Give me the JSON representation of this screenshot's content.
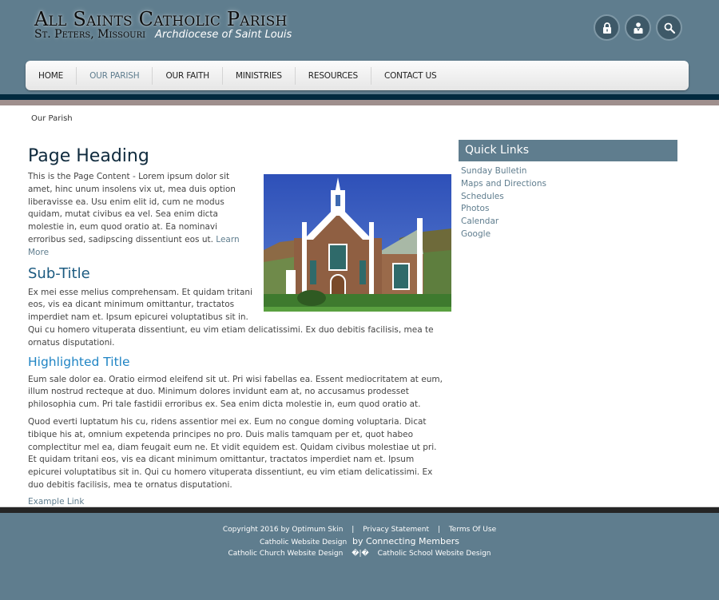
{
  "header": {
    "title": "All Saints Catholic Parish",
    "location": "St. Peters, Missouri",
    "archdiocese": "Archdiocese of Saint Louis",
    "icons": [
      "lock-icon",
      "user-icon",
      "search-icon"
    ]
  },
  "nav": {
    "items": [
      {
        "label": "HOME",
        "active": false
      },
      {
        "label": "OUR PARISH",
        "active": true
      },
      {
        "label": "OUR FAITH",
        "active": false
      },
      {
        "label": "MINISTRIES",
        "active": false
      },
      {
        "label": "RESOURCES",
        "active": false
      },
      {
        "label": "CONTACT US",
        "active": false
      }
    ]
  },
  "breadcrumb": "Our Parish",
  "main": {
    "heading": "Page Heading",
    "intro": "This is the Page Content - Lorem ipsum dolor sit amet, hinc unum insolens vix ut, mea duis option liberavisse ea. Usu enim elit id, cum ne modus quidam, mutat civibus ea vel. Sea enim dicta molestie in, eum quod oratio at. Ea nominavi erroribus sed, sadipscing dissentiunt eos ut.",
    "learn_more": "Learn More",
    "subtitle": "Sub-Title",
    "sub_para": "Ex mei esse melius comprehensam. Et quidam tritani eos, vis ea dicant minimum omittantur, tractatos imperdiet nam et. Ipsum epicurei voluptatibus sit in. Qui cu homero vituperata dissentiunt, eu vim etiam delicatissimi. Ex duo debitis facilisis, mea te ornatus disputationi.",
    "highlighted_title": "Highlighted Title",
    "hl_para1": "Eum sale dolor ea. Oratio eirmod eleifend sit ut. Pri wisi fabellas ea. Essent mediocritatem at eum, illum nostrud recteque at duo. Minimum dolores invidunt eam at, no accusamus prodesset philosophia cum. Pri tale fastidii erroribus ex. Sea enim dicta molestie in, eum quod oratio at.",
    "hl_para2": "Quod everti luptatum his cu, ridens assentior mei ex. Eum no congue doming voluptaria. Dicat tibique his at, omnium expetenda principes no pro. Duis malis tamquam per et, quot habeo complectitur mel ea, diam feugait eum ne. Et vidit equidem est. Quidam civibus molestiae ut pri. Et quidam tritani eos, vis ea dicant minimum omittantur, tractatos imperdiet nam et. Ipsum epicurei voluptatibus sit in. Qui cu homero vituperata dissentiunt, eu vim etiam delicatissimi. Ex duo debitis facilisis, mea te ornatus disputationi.",
    "example_link": "Example Link"
  },
  "sidebar": {
    "title": "Quick Links",
    "links": [
      "Sunday Bulletin",
      "Maps and Directions",
      "Schedules",
      "Photos",
      "Calendar",
      "Google"
    ]
  },
  "footer": {
    "copyright": "Copyright 2016 by Optimum Skin",
    "privacy": "Privacy Statement",
    "terms": "Terms Of Use",
    "sep": "|",
    "website_design": "Catholic Website Design",
    "by": "by Connecting Members",
    "church_design": "Catholic Church Website Design",
    "odd_sep": "�|�",
    "school_design": "Catholic School Website Design"
  },
  "colors": {
    "header_bg": "#5f7d8e",
    "band_dark": "#012a3f",
    "band_taupe": "#9f8f8d",
    "heading": "#0f2a3d",
    "subtitle": "#1b5a80",
    "highlight": "#1f84c4",
    "link": "#5f7d8e",
    "footer_bar": "#252525"
  }
}
